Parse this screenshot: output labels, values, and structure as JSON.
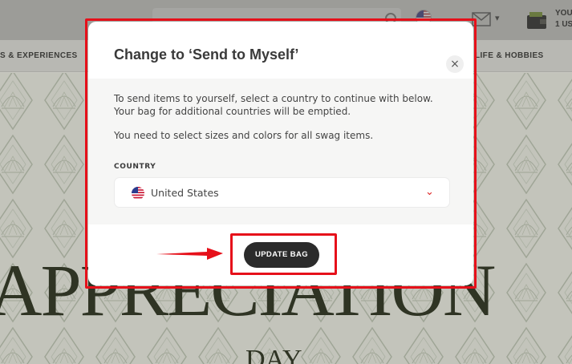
{
  "header": {
    "wallet_line1": "YOU",
    "wallet_line2": "1 US"
  },
  "nav": {
    "left_item": "S & EXPERIENCES",
    "right_item": "LIFE & HOBBIES"
  },
  "hero": {
    "title": "APPRECIATION",
    "subtitle": "DAY"
  },
  "modal": {
    "title": "Change to ‘Send to Myself’",
    "close_glyph": "×",
    "description": "To send items to yourself, select a country to continue with below. Your bag for additional countries will be emptied.",
    "note": "You need to select sizes and colors for all swag items.",
    "country_label": "COUNTRY",
    "country_value": "United States",
    "dropdown_icon": "⌄",
    "button_label": "UPDATE BAG"
  },
  "colors": {
    "annotation_red": "#e6101a",
    "button_bg": "#2b2b2b",
    "chevron_red": "#dd2222",
    "hero_text": "#2f3424"
  },
  "icons": [
    "search-icon",
    "us-flag-icon",
    "mail-icon",
    "chevron-down-icon",
    "wallet-icon",
    "close-icon",
    "annotation-arrow-icon"
  ]
}
